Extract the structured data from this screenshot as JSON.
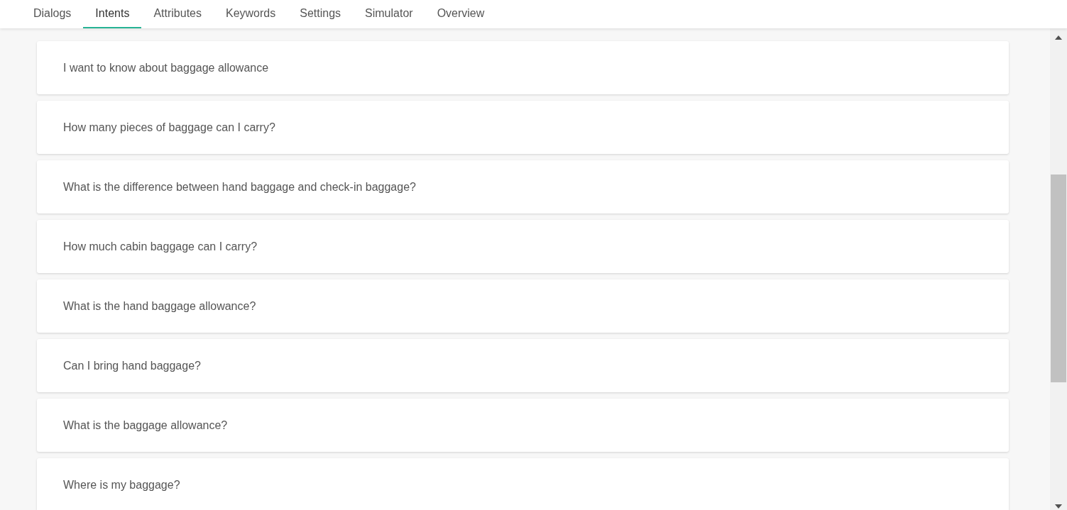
{
  "tabs": [
    {
      "label": "Dialogs",
      "selected": false
    },
    {
      "label": "Intents",
      "selected": true
    },
    {
      "label": "Attributes",
      "selected": false
    },
    {
      "label": "Keywords",
      "selected": false
    },
    {
      "label": "Settings",
      "selected": false
    },
    {
      "label": "Simulator",
      "selected": false
    },
    {
      "label": "Overview",
      "selected": false
    }
  ],
  "intents": [
    {
      "text": "I want to know about baggage allowance"
    },
    {
      "text": "How many pieces of baggage can I carry?"
    },
    {
      "text": "What is the difference between hand baggage and check-in baggage?"
    },
    {
      "text": "How much cabin baggage can I carry?"
    },
    {
      "text": "What is the hand baggage allowance?"
    },
    {
      "text": "Can I bring hand baggage?"
    },
    {
      "text": "What is the baggage allowance?"
    },
    {
      "text": "Where is my baggage?"
    }
  ]
}
